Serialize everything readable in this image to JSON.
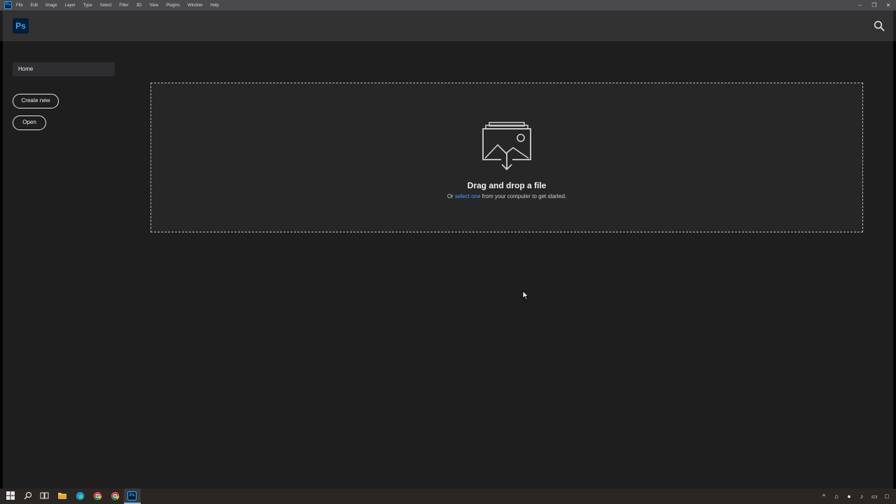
{
  "app": {
    "mini_icon": "Ps",
    "logo": "Ps",
    "brand_color": "#31a8ff"
  },
  "menubar": {
    "items": [
      "File",
      "Edit",
      "Image",
      "Layer",
      "Type",
      "Select",
      "Filter",
      "3D",
      "View",
      "Plugins",
      "Window",
      "Help"
    ],
    "controls": [
      "minimize-icon",
      "restore-icon",
      "close-icon"
    ]
  },
  "header": {
    "search_icon": "search-icon"
  },
  "sidebar": {
    "home_label": "Home",
    "create_new_label": "Create new",
    "open_label": "Open"
  },
  "dropzone": {
    "icon": "image-download-icon",
    "title": "Drag and drop a file",
    "sub_prefix": "Or",
    "sub_link": "select one",
    "sub_suffix": "from your computer to get started."
  },
  "taskbar": {
    "icons": [
      "windows-start-icon",
      "search-icon",
      "task-view-icon",
      "file-explorer-icon",
      "edge-icon",
      "chrome-icon",
      "chrome-icon",
      "photoshop-icon"
    ],
    "ps_label": "Ps",
    "tray_icons": [
      "chevron-up-icon",
      "network-icon",
      "microphone-icon",
      "volume-icon",
      "battery-icon",
      "notification-icon"
    ]
  }
}
